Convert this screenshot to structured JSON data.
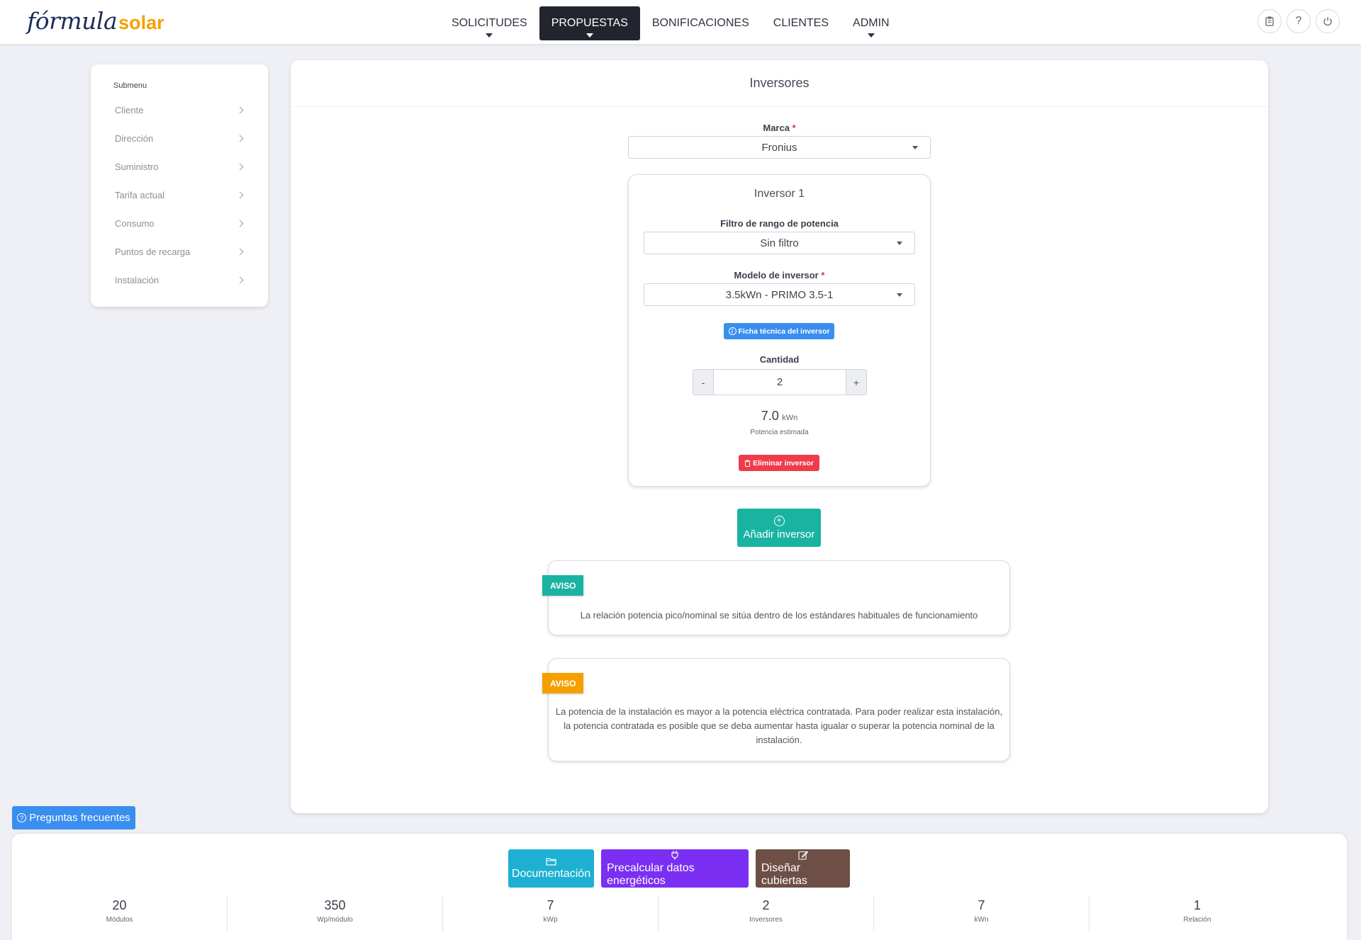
{
  "brand": {
    "logo_part1": "fórmula",
    "logo_part2": "solar"
  },
  "nav": {
    "items": [
      {
        "label": "SOLICITUDES",
        "dropdown": true,
        "active": false
      },
      {
        "label": "PROPUESTAS",
        "dropdown": true,
        "active": true
      },
      {
        "label": "BONIFICACIONES",
        "dropdown": false,
        "active": false
      },
      {
        "label": "CLIENTES",
        "dropdown": false,
        "active": false
      },
      {
        "label": "ADMIN",
        "dropdown": true,
        "active": false
      }
    ],
    "icons": [
      "clipboard-icon",
      "help-icon",
      "power-icon"
    ]
  },
  "submenu": {
    "title": "Submenu",
    "items": [
      {
        "label": "Cliente"
      },
      {
        "label": "Dirección"
      },
      {
        "label": "Suministro"
      },
      {
        "label": "Tarifa actual"
      },
      {
        "label": "Consumo"
      },
      {
        "label": "Puntos de recarga"
      },
      {
        "label": "Instalación"
      }
    ]
  },
  "main": {
    "title": "Inversores",
    "brand_label": "Marca",
    "brand_required": "*",
    "brand_value": "Fronius",
    "inverter": {
      "title": "Inversor 1",
      "filter_label": "Filtro de rango de potencia",
      "filter_value": "Sin filtro",
      "model_label": "Modelo de inversor",
      "model_required": "*",
      "model_value": "3.5kWn - PRIMO 3.5-1",
      "datasheet_button": "Ficha técnica del inversor",
      "quantity_label": "Cantidad",
      "quantity_minus": "-",
      "quantity_value": "2",
      "quantity_plus": "+",
      "power_value": "7.0",
      "power_unit": "kWn",
      "power_label": "Potencia estimada",
      "delete_button": "Eliminar inversor"
    },
    "add_button": "Añadir inversor",
    "notices": [
      {
        "tag": "AVISO",
        "color": "#1ab3a2",
        "text": "La relación potencia pico/nominal se sitúa dentro de los estándares habituales de funcionamiento"
      },
      {
        "tag": "AVISO",
        "color": "#f5a000",
        "text": "La potencia de la instalación es mayor a la potencia eléctrica contratada. Para poder realizar esta instalación, la potencia contratada es posible que se deba aumentar hasta igualar o superar la potencia nominal de la instalación."
      }
    ]
  },
  "faq_button": "Preguntas frecuentes",
  "bottom": {
    "buttons": [
      {
        "label": "Documentación",
        "icon": "folder-icon",
        "color": "#1eb0d2"
      },
      {
        "label": "Precalcular datos energéticos",
        "icon": "plug-icon",
        "color": "#7b2ff2"
      },
      {
        "label": "Diseñar cubiertas",
        "icon": "edit-icon",
        "color": "#6d4f45"
      }
    ],
    "stats": [
      {
        "value": "20",
        "label": "Módulos"
      },
      {
        "value": "350",
        "label": "Wp/módulo"
      },
      {
        "value": "7",
        "label": "kWp"
      },
      {
        "value": "2",
        "label": "Inversores"
      },
      {
        "value": "7",
        "label": "kWn"
      },
      {
        "value": "1",
        "label": "Relación"
      }
    ]
  },
  "colors": {
    "accent_dark": "#22252d",
    "blue": "#3a8ef0",
    "teal": "#1ab3a2",
    "red": "#ef3c4a",
    "orange": "#f5a000"
  }
}
